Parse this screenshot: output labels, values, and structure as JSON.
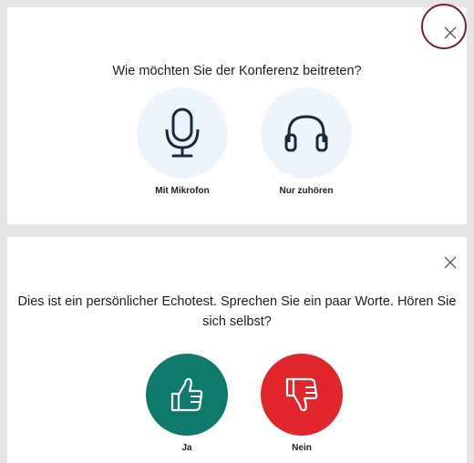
{
  "join_dialog": {
    "question": "Wie möchten Sie der Konferenz beitreten?",
    "options": [
      {
        "label": "Mit Mikrofon",
        "icon": "microphone-icon"
      },
      {
        "label": "Nur zuhören",
        "icon": "headphones-icon"
      }
    ],
    "close_icon": "close-icon"
  },
  "echo_dialog": {
    "question": "Dies ist ein persönlicher Echotest. Sprechen Sie ein paar Worte. Hören Sie sich selbst?",
    "options": [
      {
        "label": "Ja",
        "icon": "thumbs-up-icon"
      },
      {
        "label": "Nein",
        "icon": "thumbs-down-icon"
      }
    ],
    "close_icon": "close-icon"
  },
  "colors": {
    "accent_circle": "#eef4fb",
    "icon_blue": "#1b2a3a",
    "yes": "#0f7a6c",
    "no": "#e0252b",
    "highlight_ring": "#7b1e34"
  }
}
